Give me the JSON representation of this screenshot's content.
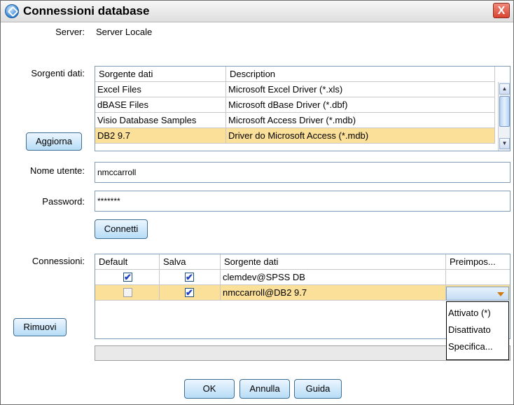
{
  "window": {
    "title": "Connessioni database",
    "close_glyph": "X"
  },
  "server": {
    "label": "Server:",
    "value": "Server Locale"
  },
  "sources": {
    "label": "Sorgenti dati:",
    "headers": [
      "Sorgente dati",
      "Description"
    ],
    "rows": [
      [
        "Excel Files",
        "Microsoft Excel Driver (*.xls)"
      ],
      [
        "dBASE Files",
        "Microsoft dBase Driver (*.dbf)"
      ],
      [
        "Visio Database Samples",
        "Microsoft Access Driver (*.mdb)"
      ],
      [
        "DB2 9.7",
        "Driver do Microsoft Access (*.mdb)"
      ]
    ],
    "selected_row": 3,
    "refresh_button": "Aggiorna"
  },
  "credentials": {
    "user_label": "Nome utente:",
    "user_value": "nmccarroll",
    "password_label": "Password:",
    "password_value": "*******",
    "connect_button": "Connetti"
  },
  "connections": {
    "label": "Connessioni:",
    "headers": [
      "Default",
      "Salva",
      "Sorgente dati",
      "Preimpos..."
    ],
    "rows": [
      {
        "default": true,
        "save": true,
        "source": "clemdev@SPSS DB",
        "preset": ""
      },
      {
        "default": false,
        "save": true,
        "source": "nmccarroll@DB2 9.7",
        "preset": ""
      }
    ],
    "selected_row": 1,
    "remove_button": "Rimuovi",
    "dropdown_options": [
      "Attivato (*)",
      "Disattivato",
      "Specifica..."
    ]
  },
  "footer": {
    "ok": "OK",
    "cancel": "Annulla",
    "help": "Guida"
  },
  "colors": {
    "selection": "#fbe09a",
    "button": "#b6dcf6",
    "check": "#2040c0"
  }
}
